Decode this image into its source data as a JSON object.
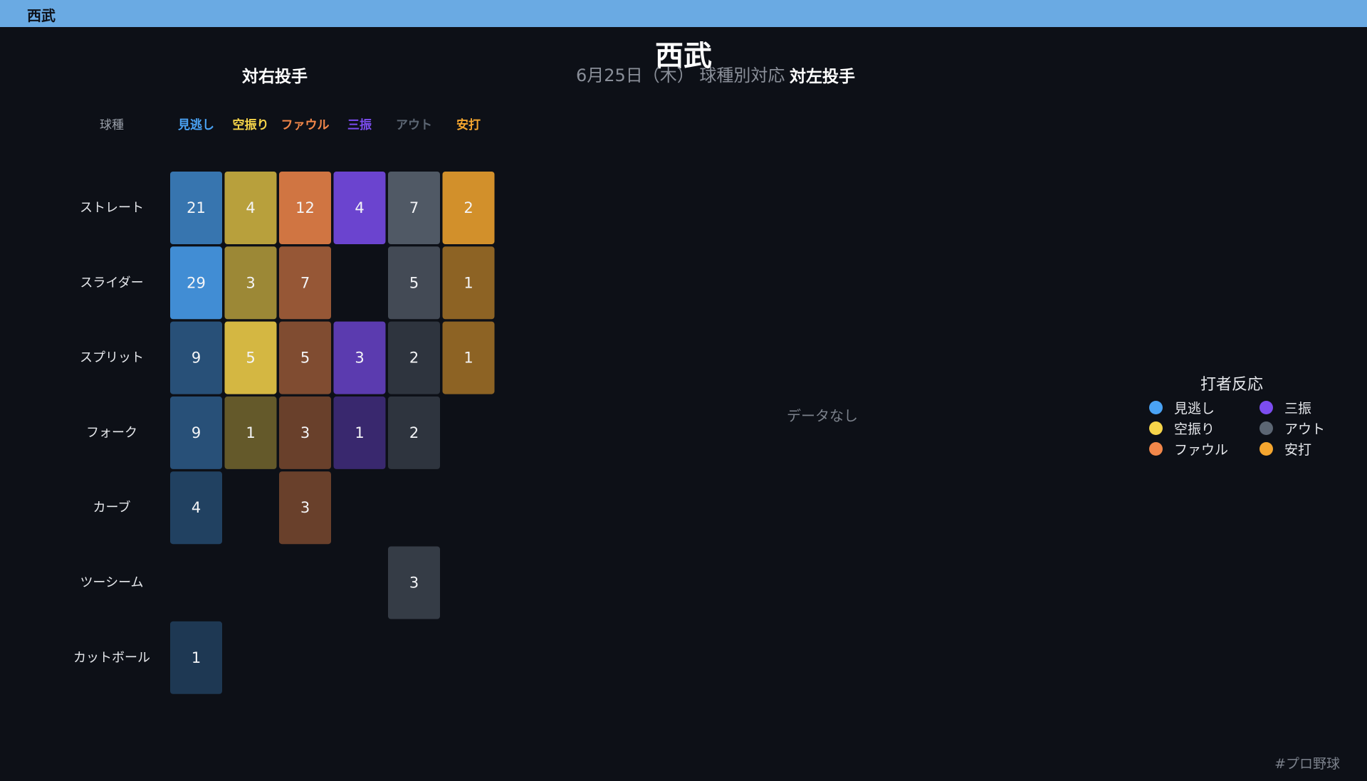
{
  "topbar": {
    "title": "西武"
  },
  "header": {
    "title": "西武",
    "subtitle": "6月25日（木） 球種別対応"
  },
  "panels": {
    "right": {
      "title": "対右投手"
    },
    "left": {
      "title": "対左投手",
      "empty_text": "データなし"
    }
  },
  "legend": {
    "title": "打者反応",
    "items": [
      {
        "label": "見逃し",
        "color": "#4aa3f5"
      },
      {
        "label": "三振",
        "color": "#7c4df0"
      },
      {
        "label": "空振り",
        "color": "#f7d54a"
      },
      {
        "label": "アウト",
        "color": "#5c6673"
      },
      {
        "label": "ファウル",
        "color": "#f2874a"
      },
      {
        "label": "安打",
        "color": "#f5a62f"
      }
    ]
  },
  "footer": {
    "tag": "#プロ野球"
  },
  "chart_data": {
    "type": "heatmap",
    "title": "対右投手",
    "row_header": "球種",
    "columns": [
      {
        "label": "見逃し",
        "color": "#4aa3f5"
      },
      {
        "label": "空振り",
        "color": "#f7d54a"
      },
      {
        "label": "ファウル",
        "color": "#f2874a"
      },
      {
        "label": "三振",
        "color": "#7c4df0"
      },
      {
        "label": "アウト",
        "color": "#5c6673"
      },
      {
        "label": "安打",
        "color": "#f5a62f"
      }
    ],
    "rows": [
      "ストレート",
      "スライダー",
      "スプリット",
      "フォーク",
      "カーブ",
      "ツーシーム",
      "カットボール"
    ],
    "values": [
      [
        21,
        4,
        12,
        4,
        7,
        2
      ],
      [
        29,
        3,
        7,
        null,
        5,
        1
      ],
      [
        9,
        5,
        5,
        3,
        2,
        1
      ],
      [
        9,
        1,
        3,
        1,
        2,
        null
      ],
      [
        4,
        null,
        3,
        null,
        null,
        null
      ],
      [
        null,
        null,
        null,
        null,
        3,
        null
      ],
      [
        1,
        null,
        null,
        null,
        null,
        null
      ]
    ],
    "column_max": [
      29,
      5,
      12,
      4,
      7,
      2
    ]
  }
}
